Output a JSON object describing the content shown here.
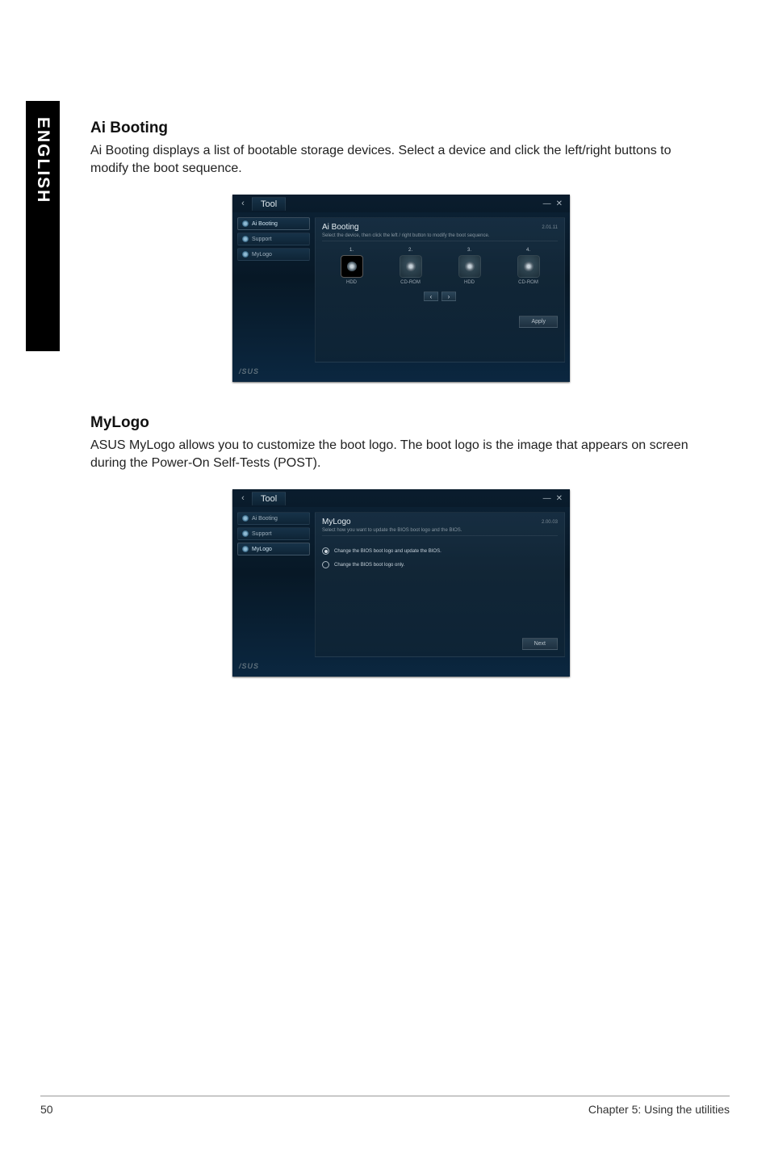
{
  "side_tab": "ENGLISH",
  "sections": {
    "aibooting": {
      "title": "Ai Booting",
      "body": "Ai Booting displays a list of bootable storage devices. Select a device and click the left/right buttons to modify the boot sequence."
    },
    "mylogo": {
      "title": "MyLogo",
      "body": "ASUS MyLogo allows you to customize the boot logo. The boot logo is the image that appears on screen during the Power-On Self-Tests (POST)."
    }
  },
  "window_common": {
    "tab_label": "Tool",
    "minimize": "—",
    "close": "✕",
    "brand": "/SUS",
    "sidebar": {
      "ai_booting": "Ai Booting",
      "support": "Support",
      "mylogo": "MyLogo"
    }
  },
  "aibooting_panel": {
    "title": "Ai Booting",
    "version": "2.01.11",
    "subtitle": "Select the device, then click the left / right button to modify the boot sequence.",
    "devices": [
      {
        "num": "1.",
        "label": "HDD"
      },
      {
        "num": "2.",
        "label": "CD-ROM"
      },
      {
        "num": "3.",
        "label": "HDD"
      },
      {
        "num": "4.",
        "label": "CD-ROM"
      }
    ],
    "nav_left": "‹",
    "nav_right": "›",
    "apply": "Apply"
  },
  "mylogo_panel": {
    "title": "MyLogo",
    "version": "2.00.03",
    "subtitle": "Select how you want to update the BIOS boot logo and the BIOS.",
    "options": {
      "opt1": "Change the BIOS boot logo and update the BIOS.",
      "opt2": "Change the BIOS boot logo only."
    },
    "next": "Next"
  },
  "footer": {
    "page": "50",
    "chapter": "Chapter 5: Using the utilities"
  }
}
